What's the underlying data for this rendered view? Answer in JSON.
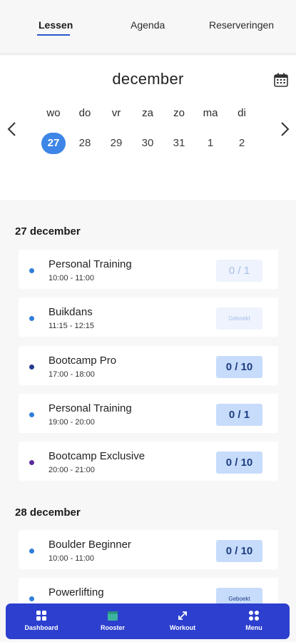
{
  "tabs": [
    {
      "label": "Lessen"
    },
    {
      "label": "Agenda"
    },
    {
      "label": "Reserveringen"
    }
  ],
  "calendar": {
    "month": "december",
    "weekdays": [
      "wo",
      "do",
      "vr",
      "za",
      "zo",
      "ma",
      "di"
    ],
    "days": [
      "27",
      "28",
      "29",
      "30",
      "31",
      "1",
      "2"
    ],
    "selected_day": "27"
  },
  "sections": [
    {
      "title": "27 december",
      "lessons": [
        {
          "name": "Personal Training",
          "time": "10:00 - 11:00",
          "badge": "0 / 1",
          "dot": "#2f7ed8",
          "state": "faded"
        },
        {
          "name": "Buikdans",
          "time": "11:15 - 12:15",
          "badge": "Geboekt",
          "dot": "#2f7ed8",
          "state": "faded"
        },
        {
          "name": "Bootcamp Pro",
          "time": "17:00 - 18:00",
          "badge": "0 / 10",
          "dot": "#233a8c",
          "state": "active"
        },
        {
          "name": "Personal Training",
          "time": "19:00 - 20:00",
          "badge": "0 / 1",
          "dot": "#2f7ed8",
          "state": "active"
        },
        {
          "name": "Bootcamp Exclusive",
          "time": "20:00 - 21:00",
          "badge": "0 / 10",
          "dot": "#5b2a9c",
          "state": "active"
        }
      ]
    },
    {
      "title": "28 december",
      "lessons": [
        {
          "name": "Boulder Beginner",
          "time": "10:00 - 11:00",
          "badge": "0 / 10",
          "dot": "#2f7ed8",
          "state": "active"
        },
        {
          "name": "Powerlifting",
          "time": "",
          "badge": "Geboekt",
          "dot": "#2f7ed8",
          "state": "active"
        }
      ]
    }
  ],
  "bottom_nav": [
    {
      "label": "Dashboard",
      "icon": "dashboard-icon"
    },
    {
      "label": "Rooster",
      "icon": "calendar-icon"
    },
    {
      "label": "Workout",
      "icon": "arrows-icon"
    },
    {
      "label": "Menu",
      "icon": "menu-icon"
    }
  ],
  "colors": {
    "accent": "#2c3fce",
    "selected_day": "#3d85e6",
    "badge_bg": "#c7dcfa",
    "badge_text": "#1c3c80"
  }
}
